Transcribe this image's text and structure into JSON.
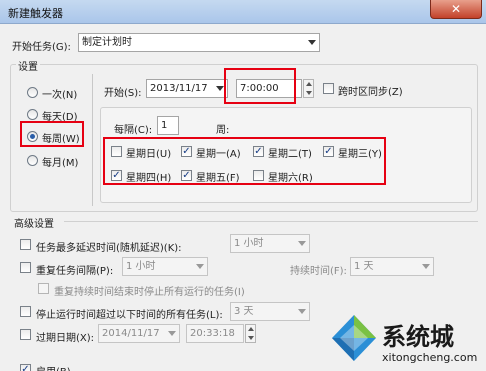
{
  "window": {
    "title": "新建触发器",
    "close": "✕"
  },
  "start_task": {
    "label": "开始任务(G):",
    "value": "制定计划时"
  },
  "settings": {
    "group_title": "设置",
    "frequency": [
      {
        "label": "一次(N)",
        "selected": false
      },
      {
        "label": "每天(D)",
        "selected": false
      },
      {
        "label": "每周(W)",
        "selected": true
      },
      {
        "label": "每月(M)",
        "selected": false
      }
    ],
    "start_label": "开始(S):",
    "start_date": "2013/11/17",
    "start_time": "7:00:00",
    "sync_timezone": "跨时区同步(Z)",
    "recur_label": "每隔(C):",
    "recur_value": "1",
    "week_label": "周:",
    "days": [
      {
        "label": "星期日(U)",
        "checked": false
      },
      {
        "label": "星期一(A)",
        "checked": true
      },
      {
        "label": "星期二(T)",
        "checked": true
      },
      {
        "label": "星期三(Y)",
        "checked": true
      },
      {
        "label": "星期四(H)",
        "checked": true
      },
      {
        "label": "星期五(F)",
        "checked": true
      },
      {
        "label": "星期六(R)",
        "checked": false
      }
    ]
  },
  "advanced": {
    "title": "高级设置",
    "delay_label": "任务最多延迟时间(随机延迟)(K):",
    "delay_value": "1 小时",
    "repeat_label": "重复任务间隔(P):",
    "repeat_value": "1 小时",
    "duration_label": "持续时间(F):",
    "duration_value": "1 天",
    "stop_repeat_label": "重复持续时间结束时停止所有运行的任务(I)",
    "stop_run_label": "停止运行时间超过以下时间的所有任务(L):",
    "stop_run_value": "3 天",
    "expire_label": "过期日期(X):",
    "expire_date": "2014/11/17",
    "expire_time": "20:33:18",
    "enabled_label": "启用(B)"
  },
  "watermark": {
    "name": "系统城",
    "url": "xitongcheng.com"
  }
}
